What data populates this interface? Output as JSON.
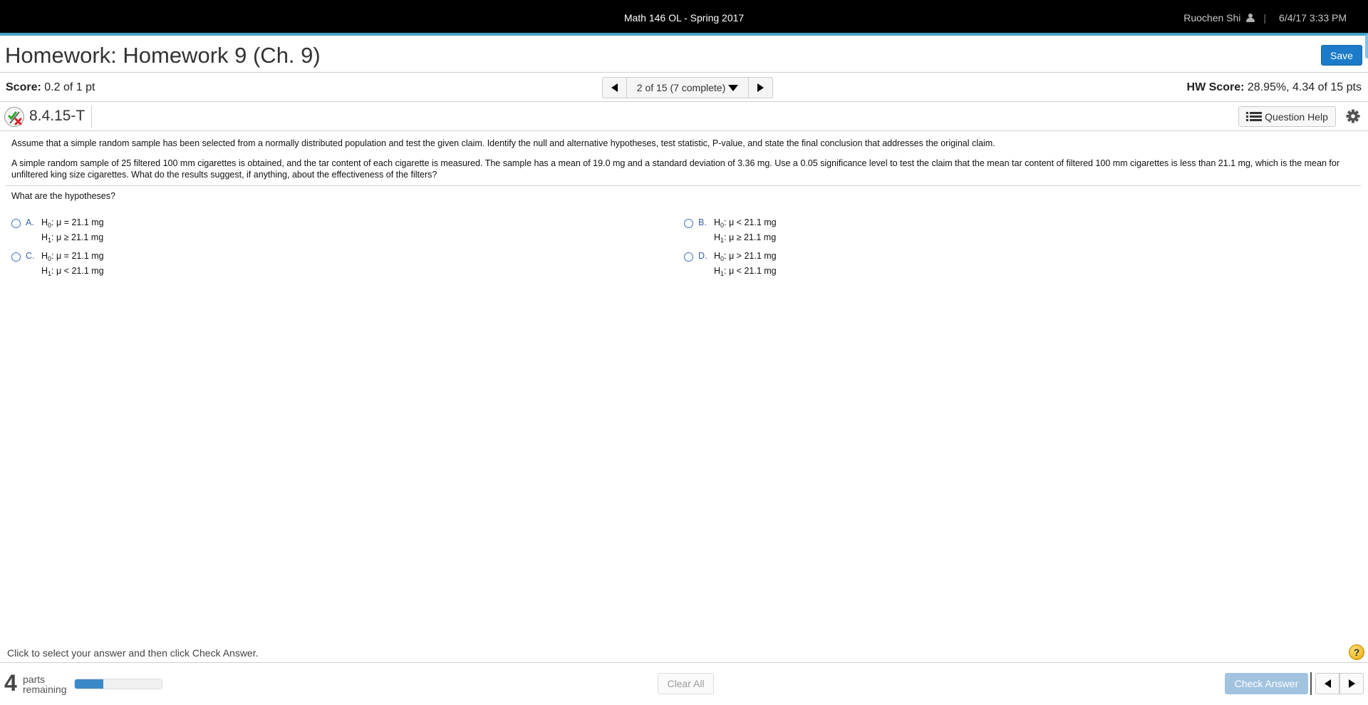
{
  "topbar": {
    "course_title": "Math 146 OL - Spring 2017",
    "user_name": "Ruochen Shi",
    "separator": "|",
    "datetime": "6/4/17 3:33 PM"
  },
  "header": {
    "title": "Homework: Homework 9 (Ch. 9)",
    "save_label": "Save"
  },
  "score": {
    "label": "Score:",
    "value": "0.2 of 1 pt",
    "hw_label": "HW Score:",
    "hw_value": "28.95%, 4.34 of 15 pts"
  },
  "navigator": {
    "current": "2 of 15 (7 complete)"
  },
  "question": {
    "id": "8.4.15-T",
    "help_label": "Question Help",
    "instructions": "Assume that a simple random sample has been selected from a normally distributed population and test the given claim. Identify the null and alternative hypotheses, test statistic, P-value, and state the final conclusion that addresses the original claim.",
    "problem": "A simple random sample of 25 filtered 100 mm cigarettes is obtained, and the tar content of each cigarette is measured. The sample has a mean of 19.0 mg and a standard deviation of 3.36 mg. Use a 0.05 significance level to test the claim that the mean tar content of filtered 100 mm cigarettes is less than 21.1 mg, which is the mean for unfiltered king size cigarettes. What do the results suggest, if anything, about the effectiveness of the filters?",
    "prompt": "What are the hypotheses?",
    "options": [
      {
        "letter": "A.",
        "h0_rel": "μ = 21.1 mg",
        "h1_rel": "μ ≥ 21.1 mg",
        "selected": false
      },
      {
        "letter": "B.",
        "h0_rel": "μ < 21.1 mg",
        "h1_rel": "μ ≥ 21.1 mg",
        "selected": false
      },
      {
        "letter": "C.",
        "h0_rel": "μ = 21.1 mg",
        "h1_rel": "μ < 21.1 mg",
        "selected": false
      },
      {
        "letter": "D.",
        "h0_rel": "μ > 21.1 mg",
        "h1_rel": "μ < 21.1 mg",
        "selected": false
      }
    ],
    "h0_symbol": "H",
    "h0_sub": "0",
    "h1_sub": "1"
  },
  "footer": {
    "hint": "Click to select your answer and then click Check Answer.",
    "help_symbol": "?",
    "parts_remaining": "4",
    "parts_label_1": "parts",
    "parts_label_2": "remaining",
    "progress_fraction": 0.33,
    "clear_all_label": "Clear All",
    "check_answer_label": "Check Answer"
  },
  "colors": {
    "topbar_accent": "#45a0c3",
    "save_button": "#1b7bc9",
    "progress_fill": "#3d88c9",
    "check_answer_disabled": "#a1c3df",
    "option_letter": "#3b5ea8"
  }
}
